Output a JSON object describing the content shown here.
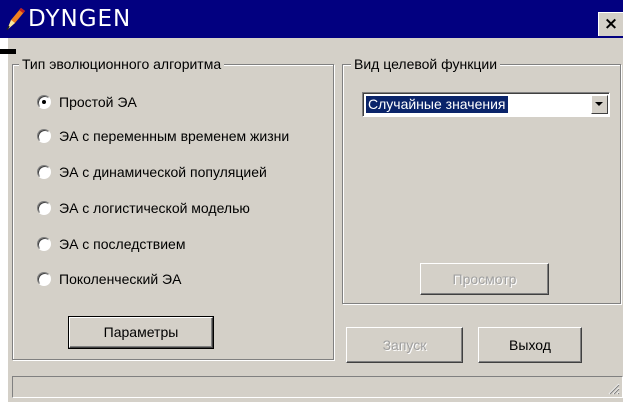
{
  "window": {
    "title": "DYNGEN",
    "close_glyph": "×",
    "app_icon": "pen-icon"
  },
  "algorithm_group": {
    "label": "Тип эволюционного алгоритма",
    "options": [
      {
        "label": "Простой ЭА",
        "checked": true
      },
      {
        "label": "ЭА с переменным временем жизни",
        "checked": false
      },
      {
        "label": "ЭА с динамической популяцией",
        "checked": false
      },
      {
        "label": "ЭА с логистической моделью",
        "checked": false
      },
      {
        "label": "ЭА с последствием",
        "checked": false
      },
      {
        "label": "Поколенческий ЭА",
        "checked": false
      }
    ],
    "params_button": "Параметры"
  },
  "target_group": {
    "label": "Вид целевой функции",
    "selected_value": "Случайные значения",
    "preview_button": "Просмотр"
  },
  "actions": {
    "run_button": "Запуск",
    "exit_button": "Выход"
  },
  "colors": {
    "titlebar": "#020080",
    "face": "#d4d0c8",
    "selection": "#0a246a",
    "disabled_text": "#a0a0a0"
  }
}
